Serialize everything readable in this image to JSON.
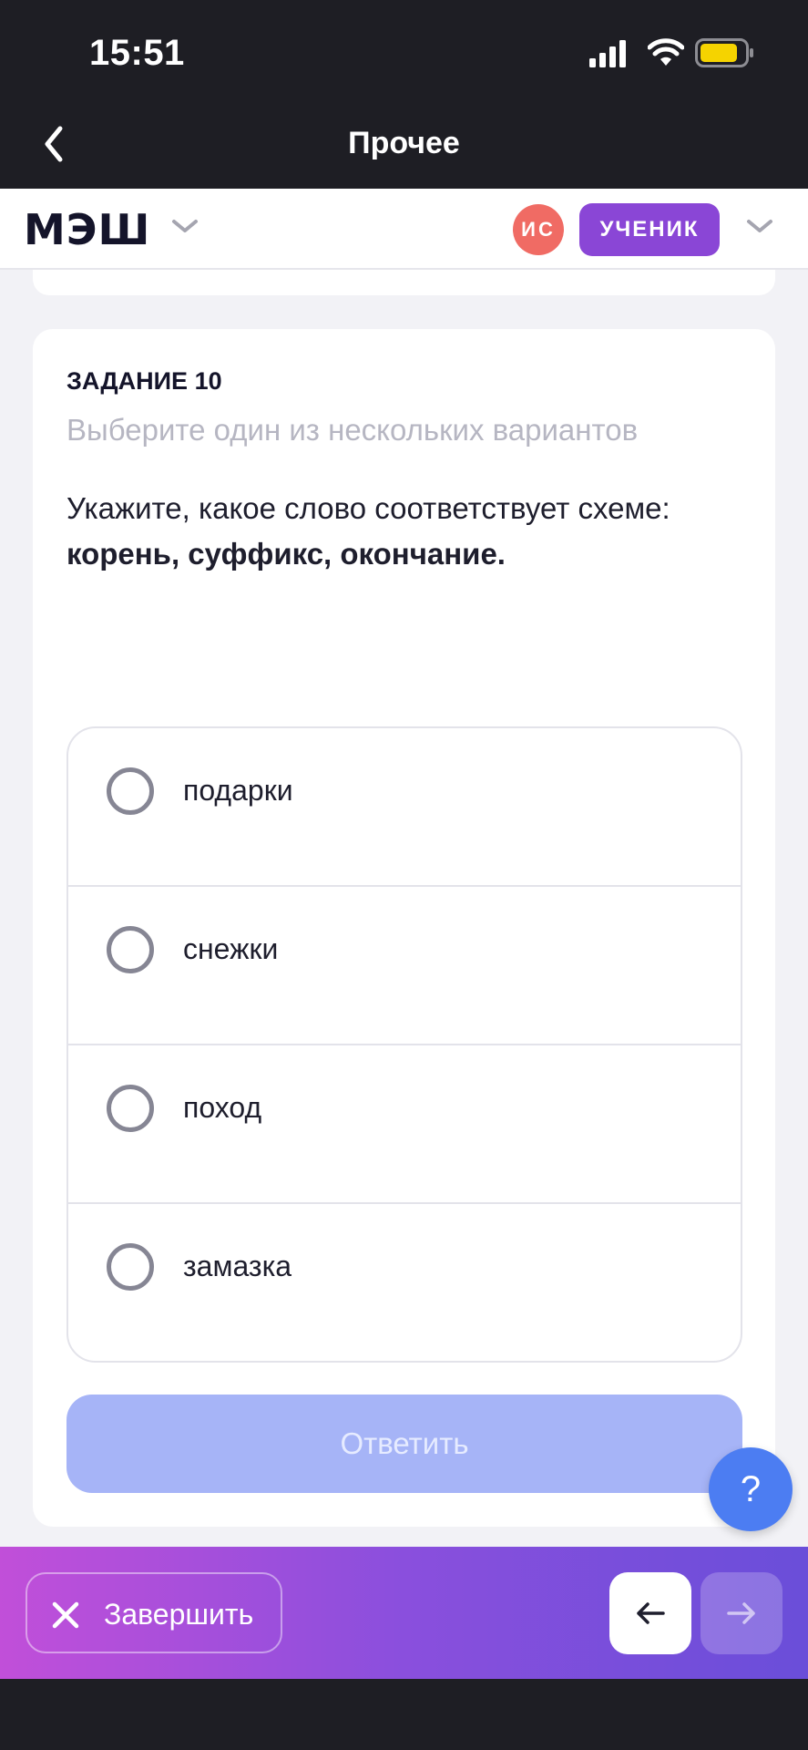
{
  "status_bar": {
    "time": "15:51",
    "icons": [
      "cellular-signal-icon",
      "wifi-icon",
      "battery-icon"
    ],
    "battery_color": "#f5d300"
  },
  "nav": {
    "back_icon": "chevron-left-icon",
    "title": "Прочее"
  },
  "header": {
    "logo": "МЭШ",
    "avatar_initials": "ИС",
    "avatar_color": "#f06b64",
    "role": "УЧЕНИК",
    "role_color": "#8a46d6"
  },
  "task": {
    "label": "ЗАДАНИЕ 10",
    "hint": "Выберите один из нескольких вариантов",
    "question": "Укажите, какое слово соответствует схеме:",
    "question_bold": "корень, суффикс, окончание.",
    "options": [
      {
        "label": "подарки",
        "selected": false
      },
      {
        "label": "снежки",
        "selected": false
      },
      {
        "label": "поход",
        "selected": false
      },
      {
        "label": "замазка",
        "selected": false
      }
    ],
    "answer_button": "Ответить",
    "answer_button_color": "#a6b4f7"
  },
  "help_button": "?",
  "bottom_bar": {
    "finish_label": "Завершить",
    "finish_icon": "close-icon",
    "prev_icon": "arrow-left-icon",
    "next_icon": "arrow-right-icon"
  }
}
